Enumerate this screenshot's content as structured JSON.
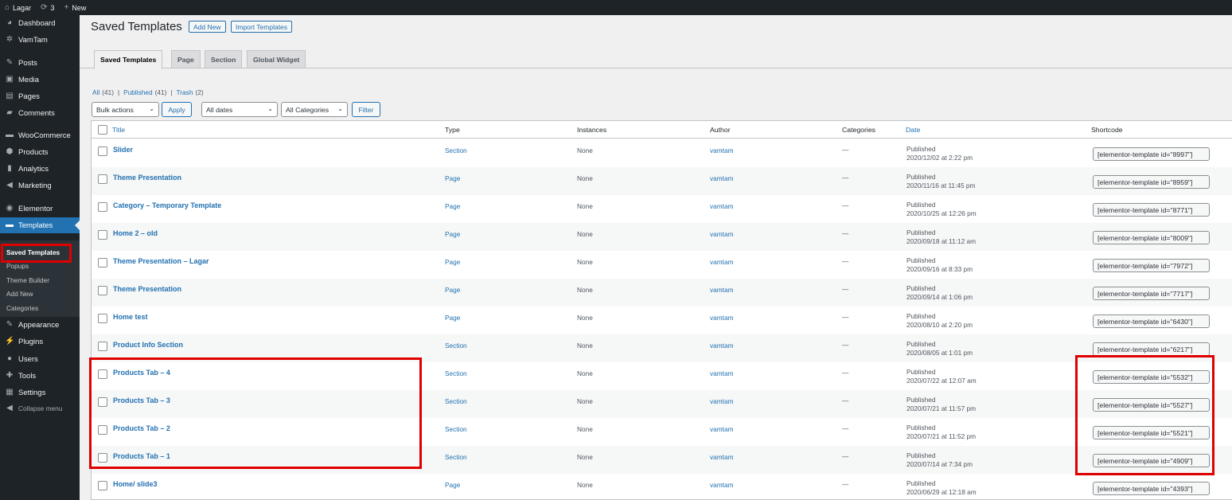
{
  "admin_bar": {
    "site_name": "Lagar",
    "updates_count": "3",
    "new_label": "New"
  },
  "sidebar": {
    "items": [
      {
        "label": "Dashboard",
        "icon": "dashboard-icon",
        "glyph": "◕"
      },
      {
        "label": "VamTam",
        "icon": "gear-icon",
        "glyph": "✲"
      },
      {
        "label": "Posts",
        "icon": "pin-icon",
        "glyph": "✎"
      },
      {
        "label": "Media",
        "icon": "media-icon",
        "glyph": "▣"
      },
      {
        "label": "Pages",
        "icon": "pages-icon",
        "glyph": "▤"
      },
      {
        "label": "Comments",
        "icon": "comment-icon",
        "glyph": "▰"
      },
      {
        "label": "WooCommerce",
        "icon": "woocommerce-icon",
        "glyph": "▬"
      },
      {
        "label": "Products",
        "icon": "box-icon",
        "glyph": "⬢"
      },
      {
        "label": "Analytics",
        "icon": "bar-chart-icon",
        "glyph": "▮"
      },
      {
        "label": "Marketing",
        "icon": "megaphone-icon",
        "glyph": "◀"
      },
      {
        "label": "Elementor",
        "icon": "elementor-icon",
        "glyph": "◉"
      },
      {
        "label": "Templates",
        "icon": "folder-icon",
        "glyph": "▬"
      },
      {
        "label": "Appearance",
        "icon": "brush-icon",
        "glyph": "✎"
      },
      {
        "label": "Plugins",
        "icon": "plug-icon",
        "glyph": "⚡"
      },
      {
        "label": "Users",
        "icon": "user-icon",
        "glyph": "●"
      },
      {
        "label": "Tools",
        "icon": "wrench-icon",
        "glyph": "✚"
      },
      {
        "label": "Settings",
        "icon": "settings-icon",
        "glyph": "▦"
      },
      {
        "label": "Collapse menu",
        "icon": "collapse-icon",
        "glyph": "◀"
      }
    ],
    "submenu": [
      "Saved Templates",
      "Popups",
      "Theme Builder",
      "Add New",
      "Categories"
    ]
  },
  "header": {
    "title": "Saved Templates",
    "add_new": "Add New",
    "import": "Import Templates"
  },
  "tabs": [
    "Saved Templates",
    "Page",
    "Section",
    "Global Widget"
  ],
  "filters": {
    "all": "All",
    "all_count": "(41)",
    "published": "Published",
    "published_count": "(41)",
    "trash": "Trash",
    "trash_count": "(2)",
    "sep": "|"
  },
  "actions": {
    "bulk": "Bulk actions",
    "apply": "Apply",
    "dates": "All dates",
    "categories": "All Categories",
    "filter": "Filter"
  },
  "table": {
    "columns": {
      "title": "Title",
      "type": "Type",
      "instances": "Instances",
      "author": "Author",
      "categories": "Categories",
      "date": "Date",
      "shortcode": "Shortcode"
    },
    "rows": [
      {
        "title": "Slider",
        "type": "Section",
        "instances": "None",
        "author": "vamtam",
        "categories": "—",
        "status": "Published",
        "date": "2020/12/02 at 2:22 pm",
        "shortcode": "[elementor-template id=\"8997\"]"
      },
      {
        "title": "Theme Presentation",
        "type": "Page",
        "instances": "None",
        "author": "vamtam",
        "categories": "—",
        "status": "Published",
        "date": "2020/11/16 at 11:45 pm",
        "shortcode": "[elementor-template id=\"8959\"]"
      },
      {
        "title": "Category – Temporary Template",
        "type": "Page",
        "instances": "None",
        "author": "vamtam",
        "categories": "—",
        "status": "Published",
        "date": "2020/10/25 at 12:26 pm",
        "shortcode": "[elementor-template id=\"8771\"]"
      },
      {
        "title": "Home 2 – old",
        "type": "Page",
        "instances": "None",
        "author": "vamtam",
        "categories": "—",
        "status": "Published",
        "date": "2020/09/18 at 11:12 am",
        "shortcode": "[elementor-template id=\"8009\"]"
      },
      {
        "title": "Theme Presentation – Lagar",
        "type": "Page",
        "instances": "None",
        "author": "vamtam",
        "categories": "—",
        "status": "Published",
        "date": "2020/09/16 at 8:33 pm",
        "shortcode": "[elementor-template id=\"7972\"]"
      },
      {
        "title": "Theme Presentation",
        "type": "Page",
        "instances": "None",
        "author": "vamtam",
        "categories": "—",
        "status": "Published",
        "date": "2020/09/14 at 1:06 pm",
        "shortcode": "[elementor-template id=\"7717\"]"
      },
      {
        "title": "Home test",
        "type": "Page",
        "instances": "None",
        "author": "vamtam",
        "categories": "—",
        "status": "Published",
        "date": "2020/08/10 at 2:20 pm",
        "shortcode": "[elementor-template id=\"6430\"]"
      },
      {
        "title": "Product Info Section",
        "type": "Section",
        "instances": "None",
        "author": "vamtam",
        "categories": "—",
        "status": "Published",
        "date": "2020/08/05 at 1:01 pm",
        "shortcode": "[elementor-template id=\"6217\"]"
      },
      {
        "title": "Products Tab – 4",
        "type": "Section",
        "instances": "None",
        "author": "vamtam",
        "categories": "—",
        "status": "Published",
        "date": "2020/07/22 at 12:07 am",
        "shortcode": "[elementor-template id=\"5532\"]"
      },
      {
        "title": "Products Tab – 3",
        "type": "Section",
        "instances": "None",
        "author": "vamtam",
        "categories": "—",
        "status": "Published",
        "date": "2020/07/21 at 11:57 pm",
        "shortcode": "[elementor-template id=\"5527\"]"
      },
      {
        "title": "Products Tab – 2",
        "type": "Section",
        "instances": "None",
        "author": "vamtam",
        "categories": "—",
        "status": "Published",
        "date": "2020/07/21 at 11:52 pm",
        "shortcode": "[elementor-template id=\"5521\"]"
      },
      {
        "title": "Products Tab – 1",
        "type": "Section",
        "instances": "None",
        "author": "vamtam",
        "categories": "—",
        "status": "Published",
        "date": "2020/07/14 at 7:34 pm",
        "shortcode": "[elementor-template id=\"4909\"]"
      },
      {
        "title": "Home/ slide3",
        "type": "Page",
        "instances": "None",
        "author": "vamtam",
        "categories": "—",
        "status": "Published",
        "date": "2020/06/29 at 12:18 am",
        "shortcode": "[elementor-template id=\"4393\"]"
      }
    ]
  },
  "colors": {
    "admin_dark": "#1d2327",
    "accent": "#2271b1",
    "highlight": "#e00000"
  }
}
